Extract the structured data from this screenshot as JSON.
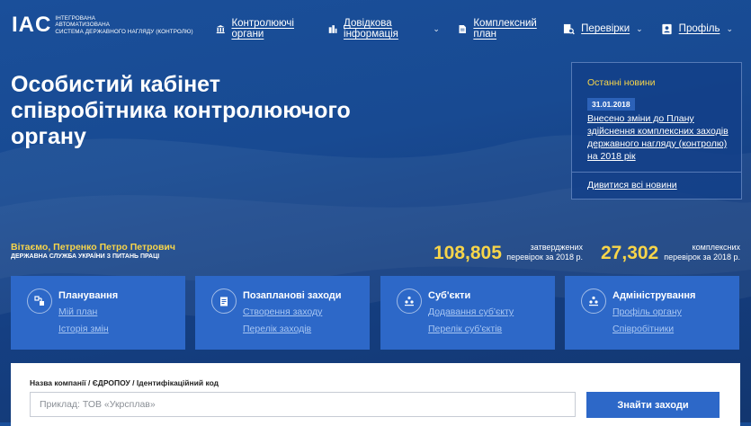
{
  "header": {
    "logo_mark": "IAC",
    "logo_lines": [
      "Інтегрована",
      "автоматизована",
      "система державного нагляду (контролю)"
    ],
    "nav": [
      {
        "label": "Контролюючі органи",
        "icon": "bank-icon",
        "dropdown": false
      },
      {
        "label": "Довідкова інформація",
        "icon": "city-icon",
        "dropdown": true
      },
      {
        "label": "Комплексний план",
        "icon": "document-icon",
        "dropdown": false
      },
      {
        "label": "Перевірки",
        "icon": "search-doc-icon",
        "dropdown": true
      },
      {
        "label": "Профіль",
        "icon": "profile-icon",
        "dropdown": true
      }
    ]
  },
  "hero": {
    "title_lines": [
      "Особистий кабінет",
      "співробітника контролюючого",
      "органу"
    ]
  },
  "news": {
    "title": "Останні новини",
    "date": "31.01.2018",
    "headline": "Внесено зміни до Плану здійснення комплексних заходів державного нагляду (контролю) на 2018 рік",
    "all_label": "Дивитися всі новини"
  },
  "user": {
    "greeting": "Вітаємо, Петренко Петро Петрович",
    "department": "ДЕРЖАВНА СЛУЖБА УКРАЇНИ З ПИТАНЬ ПРАЦІ"
  },
  "stats": [
    {
      "value": "108,805",
      "desc_lines": [
        "затверджених",
        "перевірок за 2018 р."
      ]
    },
    {
      "value": "27,302",
      "desc_lines": [
        "комплексних",
        "перевірок за 2018 р."
      ]
    }
  ],
  "cards": [
    {
      "title": "Планування",
      "icon": "planning-icon",
      "links": [
        "Мій план",
        "Історія змін"
      ]
    },
    {
      "title": "Позапланові заходи",
      "icon": "clipboard-icon",
      "links": [
        "Створення заходу",
        "Перелік заходів"
      ]
    },
    {
      "title": "Суб'єкти",
      "icon": "hierarchy-icon",
      "links": [
        "Додавання суб'єкту",
        "Перелік суб'єктів"
      ]
    },
    {
      "title": "Адміністрування",
      "icon": "admin-icon",
      "links": [
        "Профіль органу",
        "Співробітники"
      ]
    }
  ],
  "search": {
    "label": "Назва компанії / ЄДРОПОУ / Ідентифікаційний код",
    "placeholder": "Приклад: ТОВ «Укрсплав»",
    "value": "",
    "button_label": "Знайти заходи"
  },
  "colors": {
    "background": "#1a4f9a",
    "accent_yellow": "#f7d54a",
    "card_blue": "#2d68c8",
    "link_light": "#a8c6f2"
  }
}
